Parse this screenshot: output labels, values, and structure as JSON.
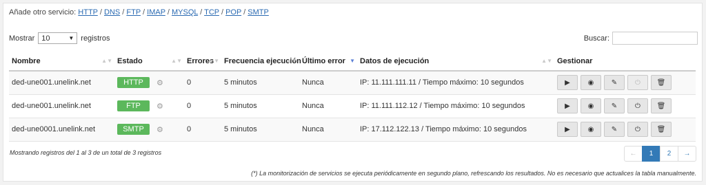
{
  "add_service": {
    "label": "Añade otro servicio:",
    "links": [
      "HTTP",
      "DNS",
      "FTP",
      "IMAP",
      "MYSQL",
      "TCP",
      "POP",
      "SMTP"
    ],
    "separator": " / "
  },
  "length": {
    "before": "Mostrar",
    "value": "10",
    "after": "registros"
  },
  "search": {
    "label": "Buscar:",
    "value": ""
  },
  "table": {
    "headers": {
      "name": "Nombre",
      "state": "Estado",
      "errors": "Errores",
      "frequency": "Frecuencia ejecución",
      "last_error": "Último error",
      "exec_data": "Datos de ejecución",
      "manage": "Gestionar"
    },
    "rows": [
      {
        "name": "ded-une001.unelink.net",
        "state": "HTTP",
        "errors": "0",
        "frequency": "5 minutos",
        "last_error": "Nunca",
        "exec_data": "IP: 11.111.111.11 / Tiempo máximo: 10 segundos"
      },
      {
        "name": "ded-une001.unelink.net",
        "state": "FTP",
        "errors": "0",
        "frequency": "5 minutos",
        "last_error": "Nunca",
        "exec_data": "IP: 11.111.112.12 / Tiempo máximo: 10 segundos"
      },
      {
        "name": "ded-une0001.unelink.net",
        "state": "SMTP",
        "errors": "0",
        "frequency": "5 minutos",
        "last_error": "Nunca",
        "exec_data": "IP: 17.112.122.13 / Tiempo máximo: 10 segundos"
      }
    ]
  },
  "icons": {
    "settings": "gear-icon",
    "run": "play-icon",
    "view": "eye-icon",
    "edit": "edit-icon",
    "power": "power-icon",
    "delete": "trash-icon"
  },
  "status_color": "#5cb85c",
  "info": "Mostrando registros del 1 al 3 de un total de 3 registros",
  "pagination": {
    "prev": "←",
    "pages": [
      "1",
      "2"
    ],
    "active": "1",
    "next": "→"
  },
  "footnote": "(*) La monitorización de servicios se ejecuta periódicamente en segundo plano, refrescando los resultados. No es necesario que actualices la tabla manualmente."
}
